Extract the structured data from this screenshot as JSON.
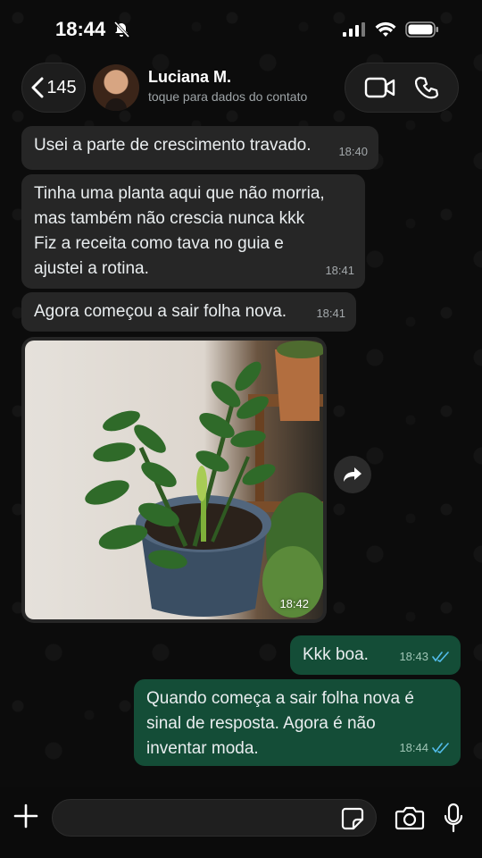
{
  "status_bar": {
    "time": "18:44"
  },
  "header": {
    "back_count": "145",
    "contact_name": "Luciana M.",
    "contact_subtitle": "toque para dados do contato"
  },
  "messages": [
    {
      "direction": "in",
      "text": "Usei a parte de crescimento travado.",
      "time": "18:40"
    },
    {
      "direction": "in",
      "lines": [
        "Tinha uma planta aqui que não morria,",
        "mas também não crescia nunca kkk",
        "Fiz a receita como tava no guia e",
        "ajustei a rotina."
      ],
      "time": "18:41"
    },
    {
      "direction": "in",
      "text": "Agora começou a sair folha nova.",
      "time": "18:41"
    },
    {
      "direction": "in",
      "type": "image",
      "image_subject": "potted-plant-photo",
      "time": "18:42"
    },
    {
      "direction": "out",
      "text": "Kkk boa.",
      "time": "18:43",
      "status": "read"
    },
    {
      "direction": "out",
      "lines": [
        "Quando começa a sair folha nova é",
        "sinal de resposta. Agora é não",
        "inventar moda."
      ],
      "time": "18:44",
      "status": "read"
    }
  ],
  "composer": {
    "input_value": ""
  },
  "colors": {
    "incoming_bubble": "#262626",
    "outgoing_bubble": "#144d37",
    "read_ticks": "#53bdeb",
    "background": "#0b0b0b"
  }
}
